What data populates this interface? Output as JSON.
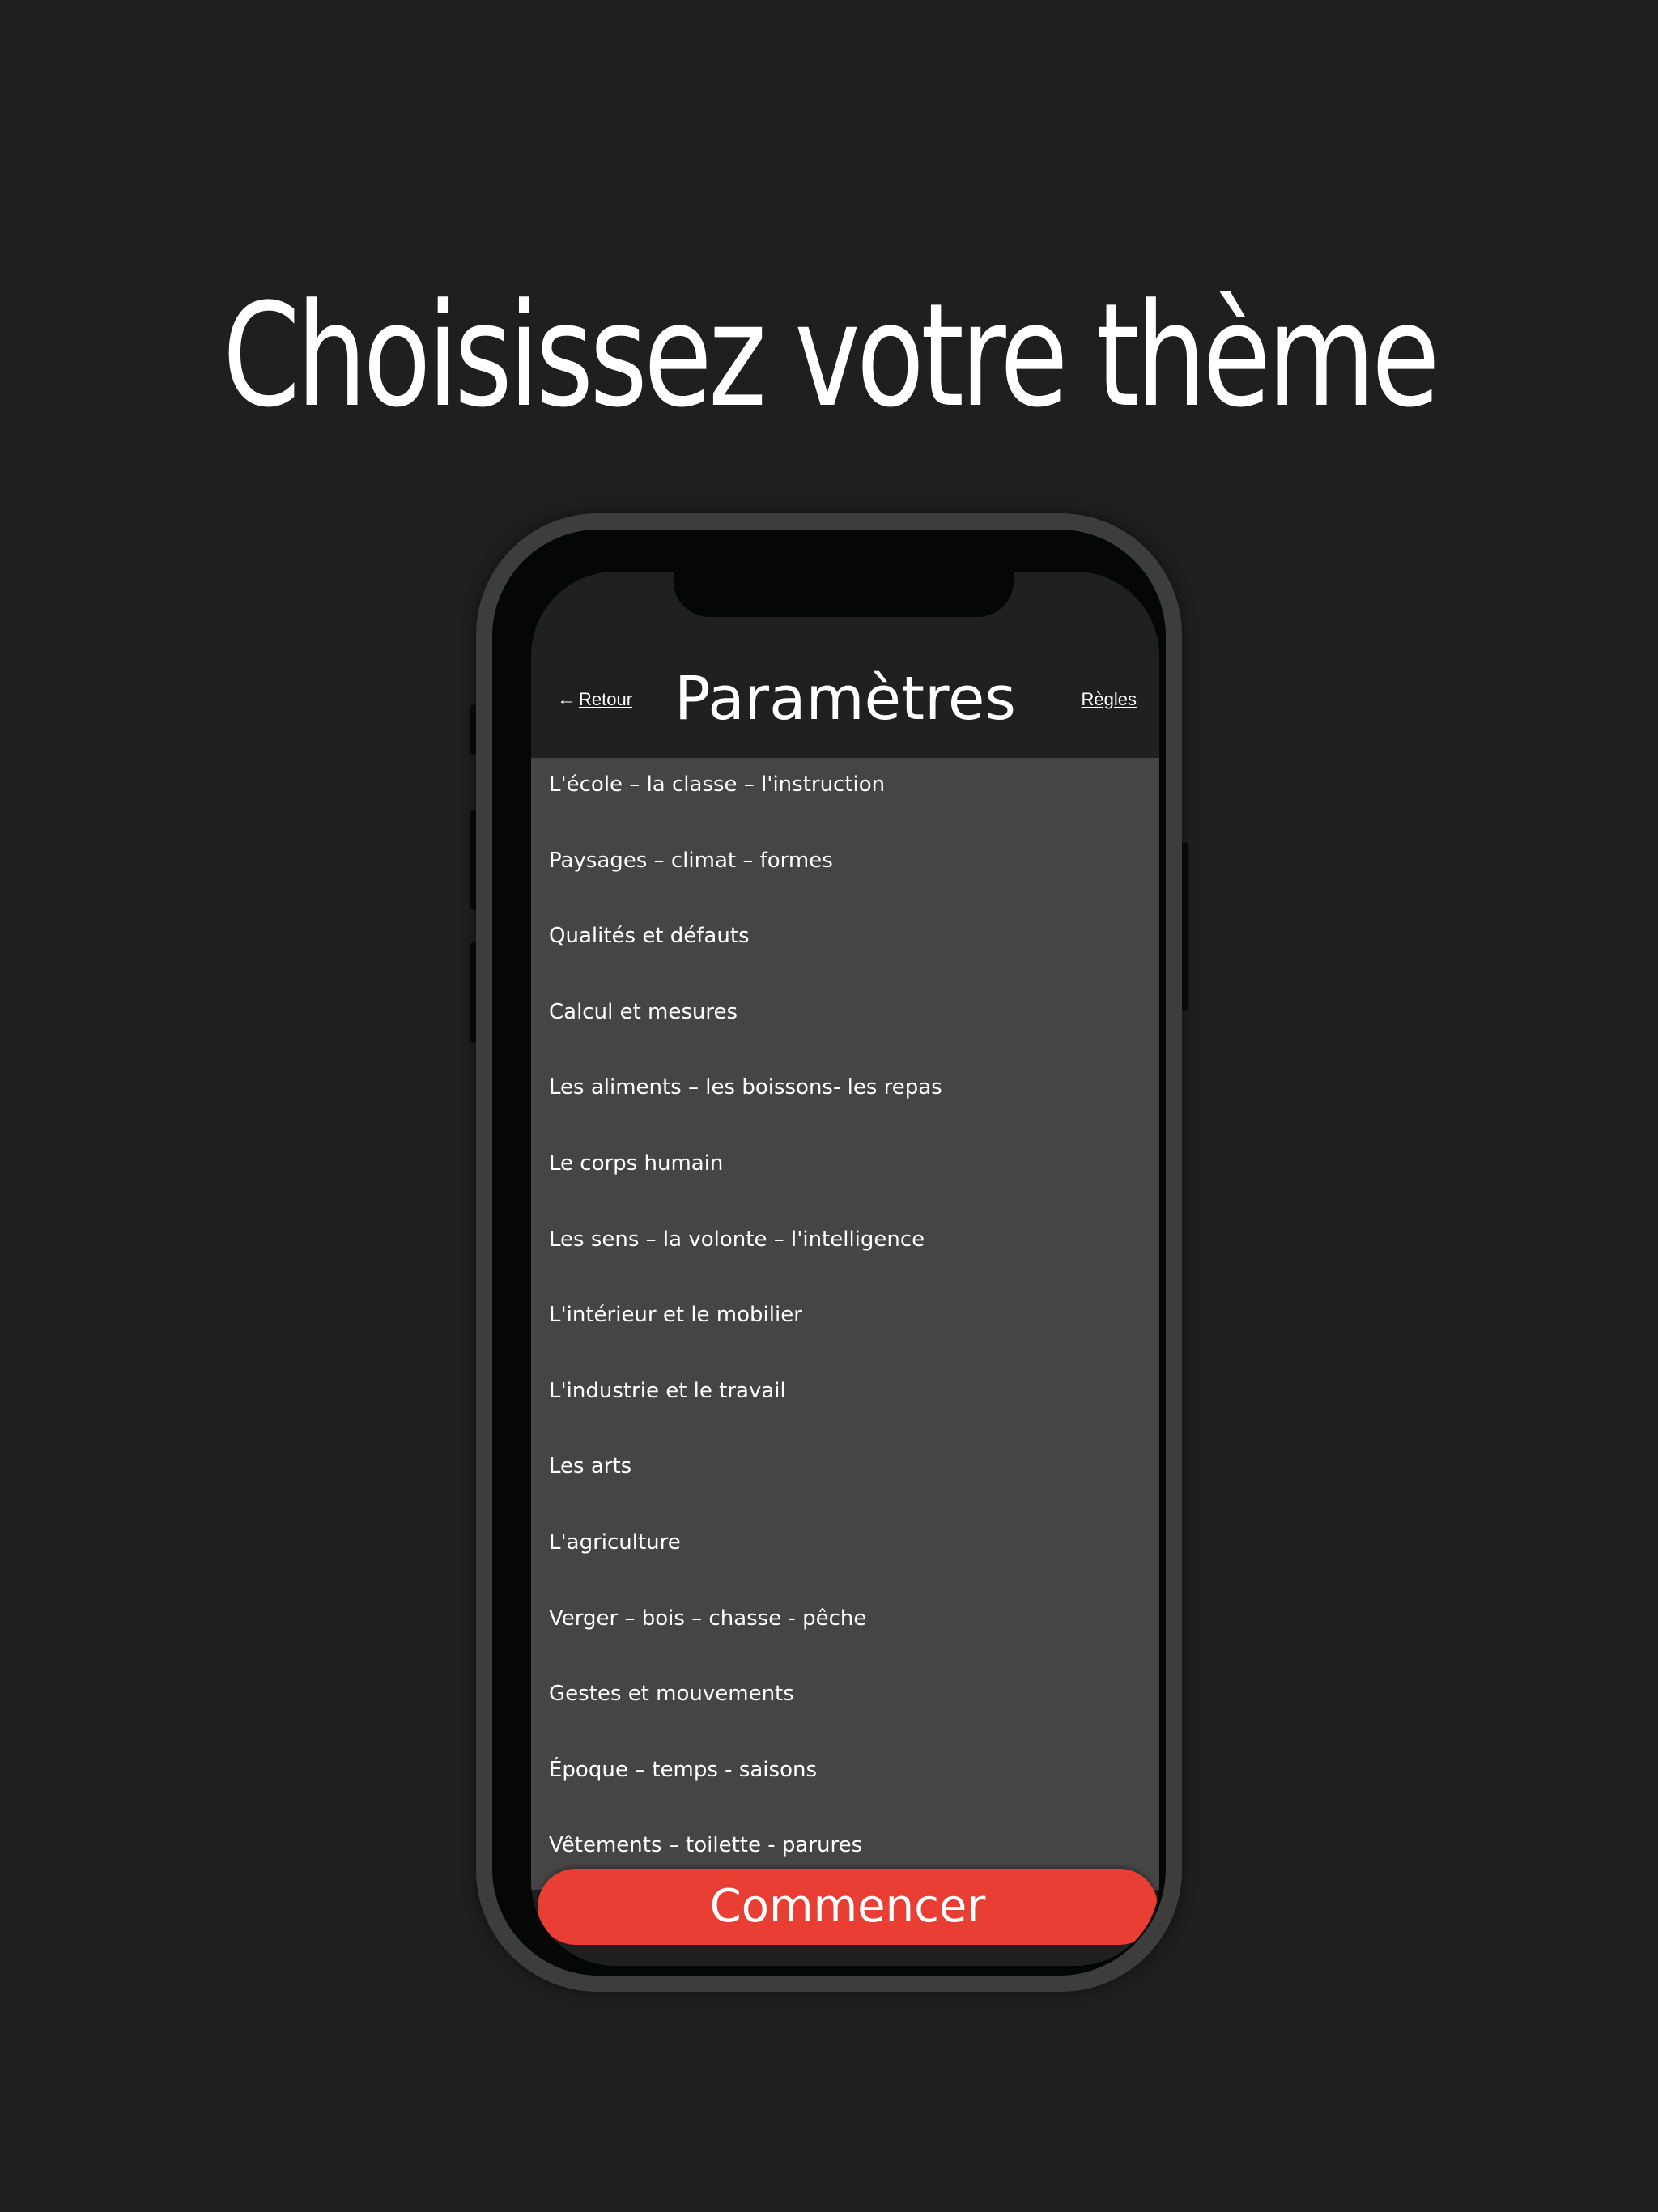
{
  "headline": "Choisissez votre thème",
  "nav": {
    "back_arrow": "←",
    "back_label": "Retour",
    "title": "Paramètres",
    "rules_label": "Règles"
  },
  "themes": [
    "L'école – la classe – l'instruction",
    "Paysages – climat – formes",
    "Qualités et défauts",
    "Calcul et mesures",
    "Les aliments – les boissons- les repas",
    "Le corps humain",
    "Les sens – la volonte – l'intelligence",
    "L'intérieur et le mobilier",
    "L'industrie et le travail",
    "Les arts",
    "L'agriculture",
    "Verger – bois – chasse - pêche",
    "Gestes et mouvements",
    "Époque – temps - saisons",
    "Vêtements – toilette - parures"
  ],
  "start_button": "Commencer",
  "colors": {
    "background": "#1f1f1f",
    "list_background": "#454545",
    "accent": "#e93e33",
    "text": "#ffffff"
  }
}
